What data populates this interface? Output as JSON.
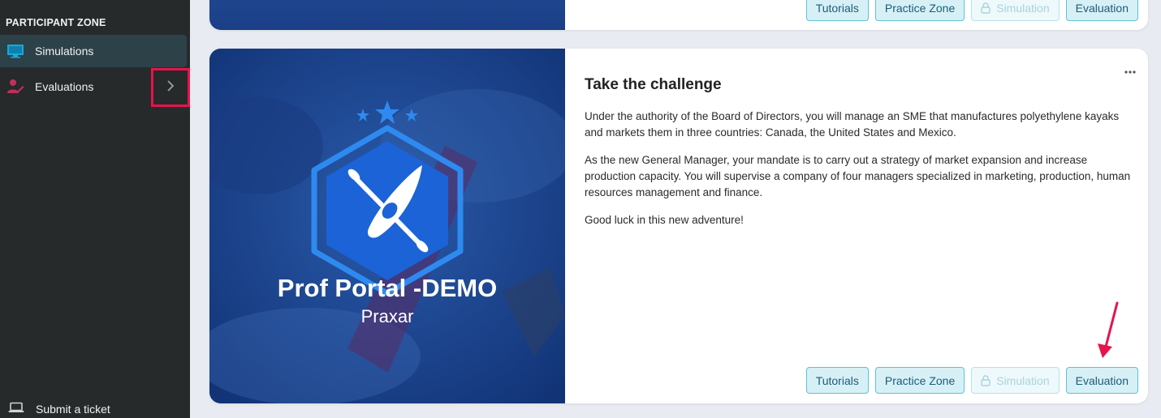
{
  "sidebar": {
    "section_title": "PARTICIPANT ZONE",
    "items": [
      {
        "label": "Simulations",
        "icon": "monitor-icon",
        "active": true
      },
      {
        "label": "Evaluations",
        "icon": "user-edit-icon",
        "active": false
      }
    ],
    "submit_label": "Submit a ticket"
  },
  "cards": {
    "top": {
      "buttons": {
        "tutorials": "Tutorials",
        "practice": "Practice Zone",
        "simulation": "Simulation",
        "evaluation": "Evaluation"
      }
    },
    "main": {
      "image_title": "Prof Portal -DEMO",
      "image_subtitle": "Praxar",
      "title": "Take the challenge",
      "paragraphs": [
        "Under the authority of the Board of Directors, you will manage an SME that manufactures polyethylene kayaks and markets them in three countries: Canada, the United States and Mexico.",
        "As the new General Manager, your mandate is to carry out a strategy of market expansion and increase production capacity. You will supervise a company of four managers specialized in marketing, production, human resources management and finance.",
        "Good luck in this new adventure!"
      ],
      "buttons": {
        "tutorials": "Tutorials",
        "practice": "Practice Zone",
        "simulation": "Simulation",
        "evaluation": "Evaluation"
      }
    }
  },
  "colors": {
    "sidebar_bg": "#262a2b",
    "active_bg": "#2d4149",
    "accent": "#e8124c",
    "button_bg": "#d7f0f6",
    "button_border": "#5bc2d8",
    "hero_blue": "#1f6fd8"
  }
}
